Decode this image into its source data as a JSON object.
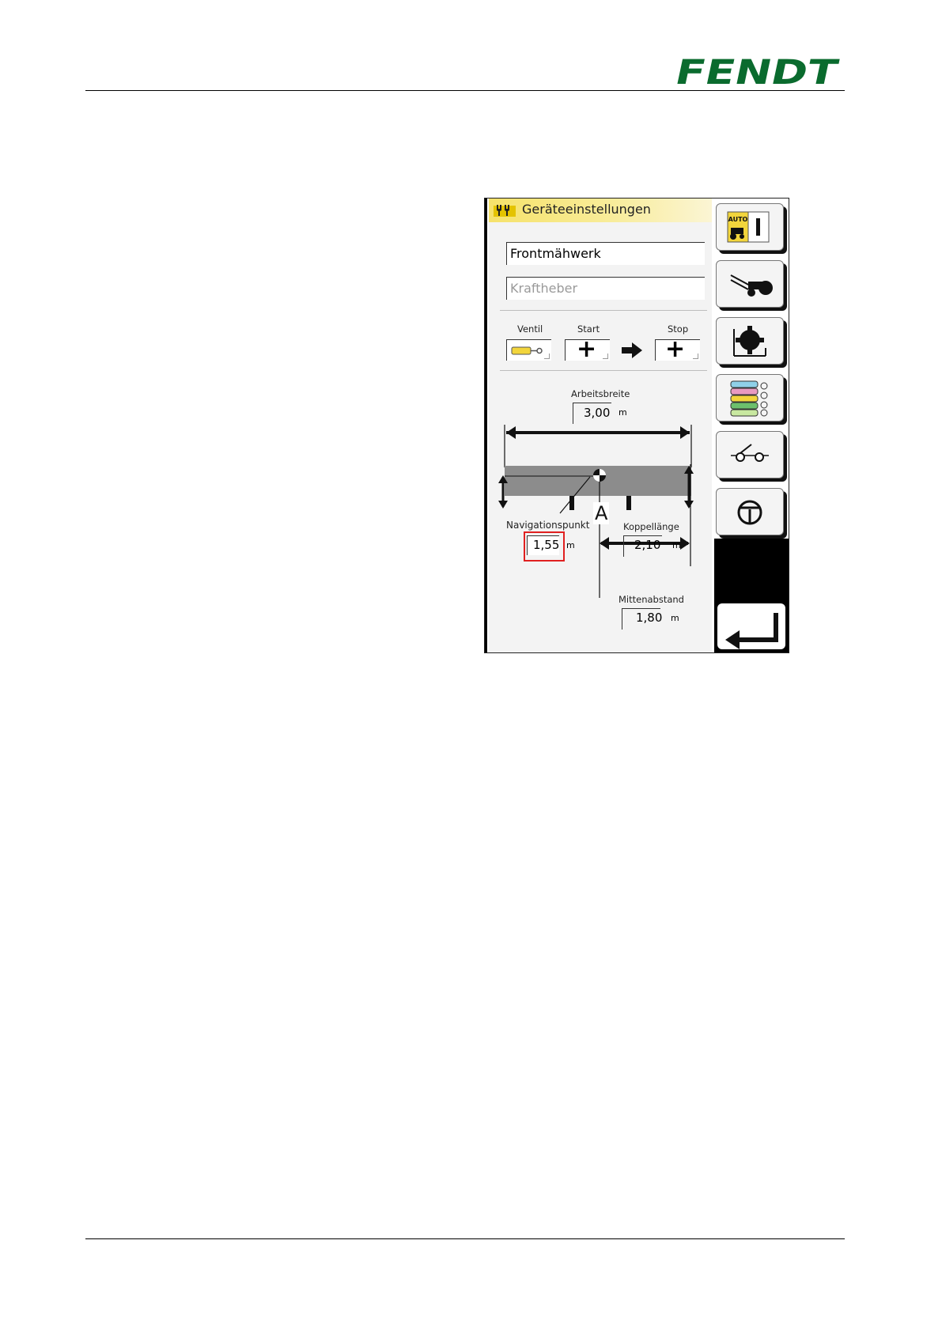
{
  "brand": {
    "logo_text": "FENDT",
    "color": "#0a6b2e"
  },
  "screen": {
    "title": "Geräteeinstellungen",
    "implement_name": "Frontmähwerk",
    "attachment": "Kraftheber",
    "valve_section": {
      "ventil_label": "Ventil",
      "start_label": "Start",
      "stop_label": "Stop"
    },
    "arbeitsbreite": {
      "label": "Arbeitsbreite",
      "value": "3,00",
      "unit": "m"
    },
    "navigationspunkt": {
      "label": "Navigationspunkt",
      "value": "1,55",
      "unit": "m"
    },
    "koppellaenge": {
      "label": "Koppellänge",
      "value": "2,10",
      "unit": "m"
    },
    "mittenabstand": {
      "label": "Mittenabstand",
      "value": "1,80",
      "unit": "m"
    },
    "callout": "A",
    "sidebar": [
      {
        "icon": "auto-mode-icon",
        "text": "AUTO"
      },
      {
        "icon": "tractor-implement-icon"
      },
      {
        "icon": "gear-icon"
      },
      {
        "icon": "hydraulic-valves-icon"
      },
      {
        "icon": "coupling-icon"
      },
      {
        "icon": "steering-wheel-icon"
      },
      {
        "icon": "back-arrow-icon"
      }
    ]
  }
}
